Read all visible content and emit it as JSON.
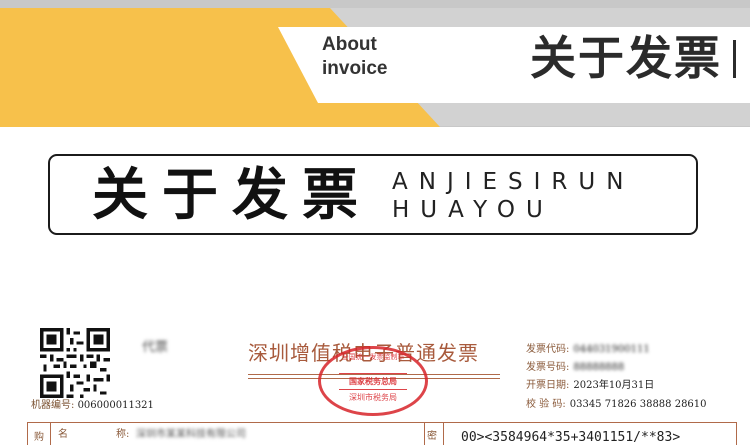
{
  "header": {
    "about_line1": "About",
    "about_line2": "invoice",
    "title": "关于发票",
    "colors": {
      "accent": "#f7c14b",
      "gray": "#c8c8c8",
      "text": "#2b2b2b"
    }
  },
  "title_box": {
    "title": "关于发票",
    "subtitle_line1": "ANJIESIRUN",
    "subtitle_line2": "HUAYOU"
  },
  "invoice": {
    "copy_tag": "代票",
    "title": "深圳增值税电子普通发票",
    "machine_label": "机器编号:",
    "machine_no": "006000011321",
    "seal": {
      "top": "全国统一发票监制章",
      "middle": "国家税务总局",
      "bottom": "深圳市税务局",
      "color": "#d8242a"
    },
    "meta": {
      "code_label": "发票代码:",
      "code_value": "044031900111",
      "number_label": "发票号码:",
      "number_value": "88888888",
      "date_label": "开票日期:",
      "date_value": "2023年10月31日",
      "check_label": "校 验 码:",
      "check_value": "03345 71826 38888 28610"
    },
    "buyer_label": "购",
    "name_label": "名",
    "name_label2": "称:",
    "buyer_name": "深圳市某某科技有限公司",
    "secret_label": "密",
    "cipher": "00><3584964*35+3401151/**83>"
  }
}
